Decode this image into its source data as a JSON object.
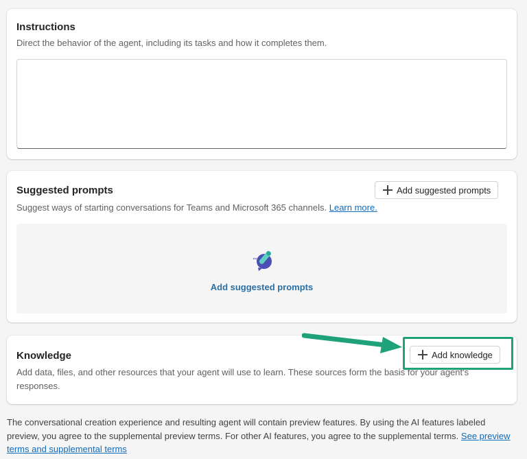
{
  "instructions": {
    "title": "Instructions",
    "description": "Direct the behavior of the agent, including its tasks and how it completes them.",
    "value": ""
  },
  "suggested_prompts": {
    "title": "Suggested prompts",
    "add_button_label": "Add suggested prompts",
    "description": "Suggest ways of starting conversations for Teams and Microsoft 365 channels.",
    "learn_more": "Learn more.",
    "empty_action_label": "Add suggested prompts"
  },
  "knowledge": {
    "title": "Knowledge",
    "add_button_label": "Add knowledge",
    "description": "Add data, files, and other resources that your agent will use to learn. These sources form the basis for your agent's responses."
  },
  "footer": {
    "text": "The conversational creation experience and resulting agent will contain preview features. By using the AI features labeled preview, you agree to the supplemental preview terms. For other AI features, you agree to the supplemental terms.",
    "link": "See preview terms and supplemental terms"
  },
  "annotation": {
    "highlight_color": "#1fa27a",
    "arrow_color": "#1fa27a"
  }
}
